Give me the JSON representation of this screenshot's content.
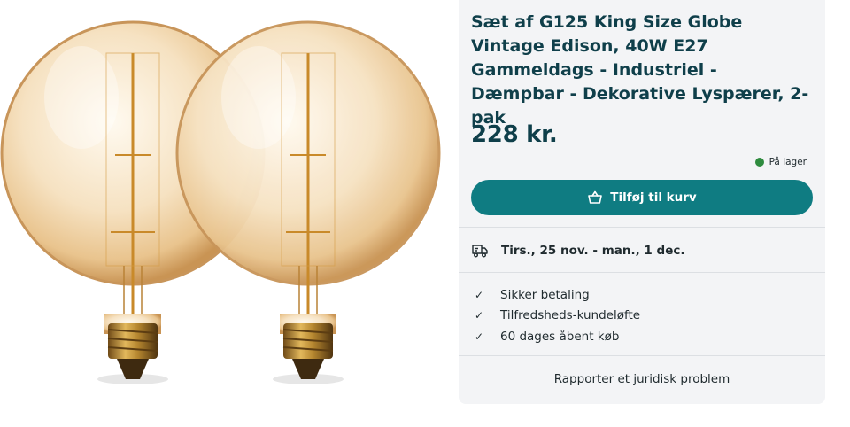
{
  "product": {
    "title": "Sæt af G125 King Size Globe Vintage Edison, 40W E27 Gammeldags - Industriel - Dæmpbar - Dekorative Lyspærer, 2-pak",
    "image_icon": "edison-globe-bulbs-image",
    "price": "228 kr.",
    "stock_status": "På lager",
    "stock_color": "#2e8b3e"
  },
  "actions": {
    "add_to_cart_label": "Tilføj til kurv",
    "add_to_cart_icon": "shopping-basket-icon",
    "accent_color": "#0f7c82"
  },
  "delivery": {
    "icon": "delivery-truck-icon",
    "dates": "Tirs., 25 nov. - man., 1 dec."
  },
  "features": [
    {
      "icon": "check-icon",
      "label": "Sikker betaling"
    },
    {
      "icon": "check-icon",
      "label": "Tilfredsheds-kundeløfte"
    },
    {
      "icon": "check-icon",
      "label": "60 dages åbent køb"
    }
  ],
  "report_link": "Rapporter et juridisk problem"
}
